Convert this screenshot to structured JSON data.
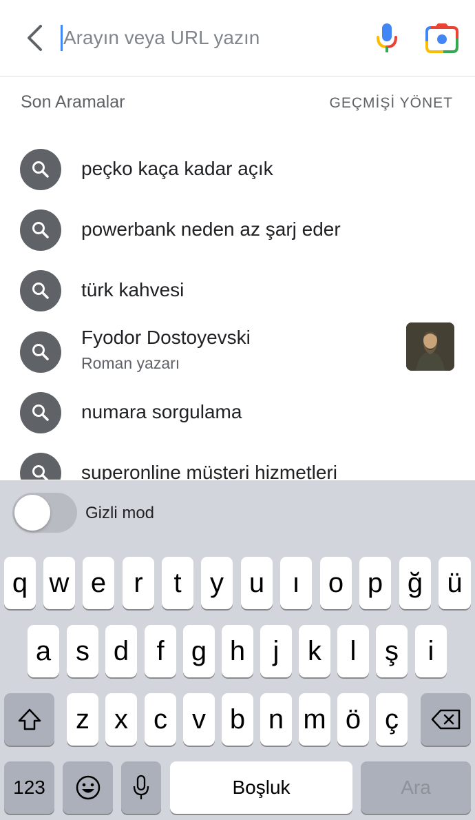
{
  "search": {
    "placeholder": "Arayın veya URL yazın"
  },
  "icons": {
    "back": "chevron-left-icon",
    "mic": "microphone-icon",
    "lens": "google-lens-icon",
    "search": "search-icon",
    "shift": "shift-icon",
    "backspace": "backspace-icon",
    "emoji": "emoji-icon",
    "dictation": "microphone-icon"
  },
  "recent": {
    "title": "Son Aramalar",
    "manage_label": "GEÇMİŞİ YÖNET"
  },
  "suggestions": [
    {
      "text": "peçko kaça kadar açık"
    },
    {
      "text": "powerbank neden az şarj eder"
    },
    {
      "text": "türk kahvesi"
    },
    {
      "text": "Fyodor Dostoyevski",
      "subtitle": "Roman yazarı"
    },
    {
      "text": "numara sorgulama"
    },
    {
      "text": "superonline müşteri hizmetleri"
    }
  ],
  "incognito": {
    "label": "Gizli mod",
    "enabled": false
  },
  "keyboard": {
    "row1": [
      "q",
      "w",
      "e",
      "r",
      "t",
      "y",
      "u",
      "ı",
      "o",
      "p",
      "ğ",
      "ü"
    ],
    "row2": [
      "a",
      "s",
      "d",
      "f",
      "g",
      "h",
      "j",
      "k",
      "l",
      "ş",
      "i"
    ],
    "row3": [
      "z",
      "x",
      "c",
      "v",
      "b",
      "n",
      "m",
      "ö",
      "ç"
    ],
    "numbers_label": "123",
    "space_label": "Boşluk",
    "go_label": "Ara"
  },
  "colors": {
    "accent": "#4285f4",
    "search_circle": "#5f6368",
    "keyboard_bg": "#d2d5db",
    "dark_key": "#abb0ba"
  }
}
